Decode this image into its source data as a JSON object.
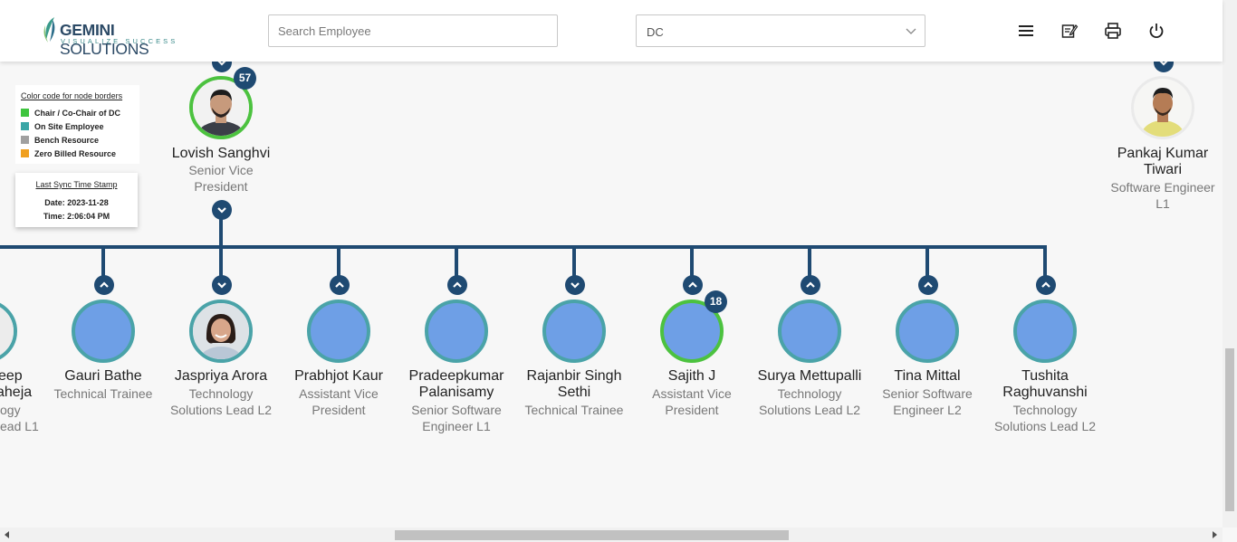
{
  "header": {
    "logo_main_bold": "GEMINI",
    "logo_main_light": " SOLUTIONS",
    "logo_tagline": "VISUALIZE SUCCESS",
    "search_placeholder": "Search Employee",
    "dropdown_value": "DC",
    "icons": [
      "hamburger-menu-icon",
      "edit-note-icon",
      "print-icon",
      "power-icon"
    ]
  },
  "legend": {
    "title": "Color code for node borders",
    "items": [
      {
        "label": "Chair / Co-Chair of DC",
        "color": "#3ec53e"
      },
      {
        "label": "On Site Employee",
        "color": "#3aa6a6"
      },
      {
        "label": "Bench Resource",
        "color": "#a0a0a0"
      },
      {
        "label": "Zero Billed Resource",
        "color": "#f0a020"
      }
    ]
  },
  "sync": {
    "title": "Last Sync Time Stamp",
    "date": "Date: 2023-11-28",
    "time": "Time: 2:06:04 PM"
  },
  "top_nodes": [
    {
      "name": "Lovish Sanghvi",
      "title_l1": "Senior Vice",
      "title_l2": "President",
      "badge": "57"
    },
    {
      "name_l1": "Pankaj Kumar",
      "name_l2": "Tiwari",
      "title_l1": "Software Engineer",
      "title_l2": "L1"
    }
  ],
  "children": [
    {
      "name_l1": "eep",
      "name_l2": "aheja",
      "title_l1": "ogy",
      "title_l2": "ead L1"
    },
    {
      "name_l1": "Gauri Bathe",
      "title_l1": "Technical Trainee"
    },
    {
      "name_l1": "Jaspriya Arora",
      "title_l1": "Technology",
      "title_l2": "Solutions Lead L2"
    },
    {
      "name_l1": "Prabhjot Kaur",
      "title_l1": "Assistant Vice",
      "title_l2": "President"
    },
    {
      "name_l1": "Pradeepkumar",
      "name_l2": "Palanisamy",
      "title_l1": "Senior Software",
      "title_l2": "Engineer L1"
    },
    {
      "name_l1": "Rajanbir Singh",
      "name_l2": "Sethi",
      "title_l1": "Technical Trainee"
    },
    {
      "name_l1": "Sajith J",
      "title_l1": "Assistant Vice",
      "title_l2": "President",
      "badge": "18"
    },
    {
      "name_l1": "Surya Mettupalli",
      "title_l1": "Technology",
      "title_l2": "Solutions Lead L2"
    },
    {
      "name_l1": "Tina Mittal",
      "title_l1": "Senior Software",
      "title_l2": "Engineer L2"
    },
    {
      "name_l1": "Tushita",
      "name_l2": "Raghuvanshi",
      "title_l1": "Technology",
      "title_l2": "Solutions Lead L2"
    }
  ],
  "colors": {
    "tree_line": "#1f4a72",
    "node_fill": "#6e9fe6",
    "onsite_border": "#4aa3a8",
    "chair_border": "#4cc23f"
  }
}
